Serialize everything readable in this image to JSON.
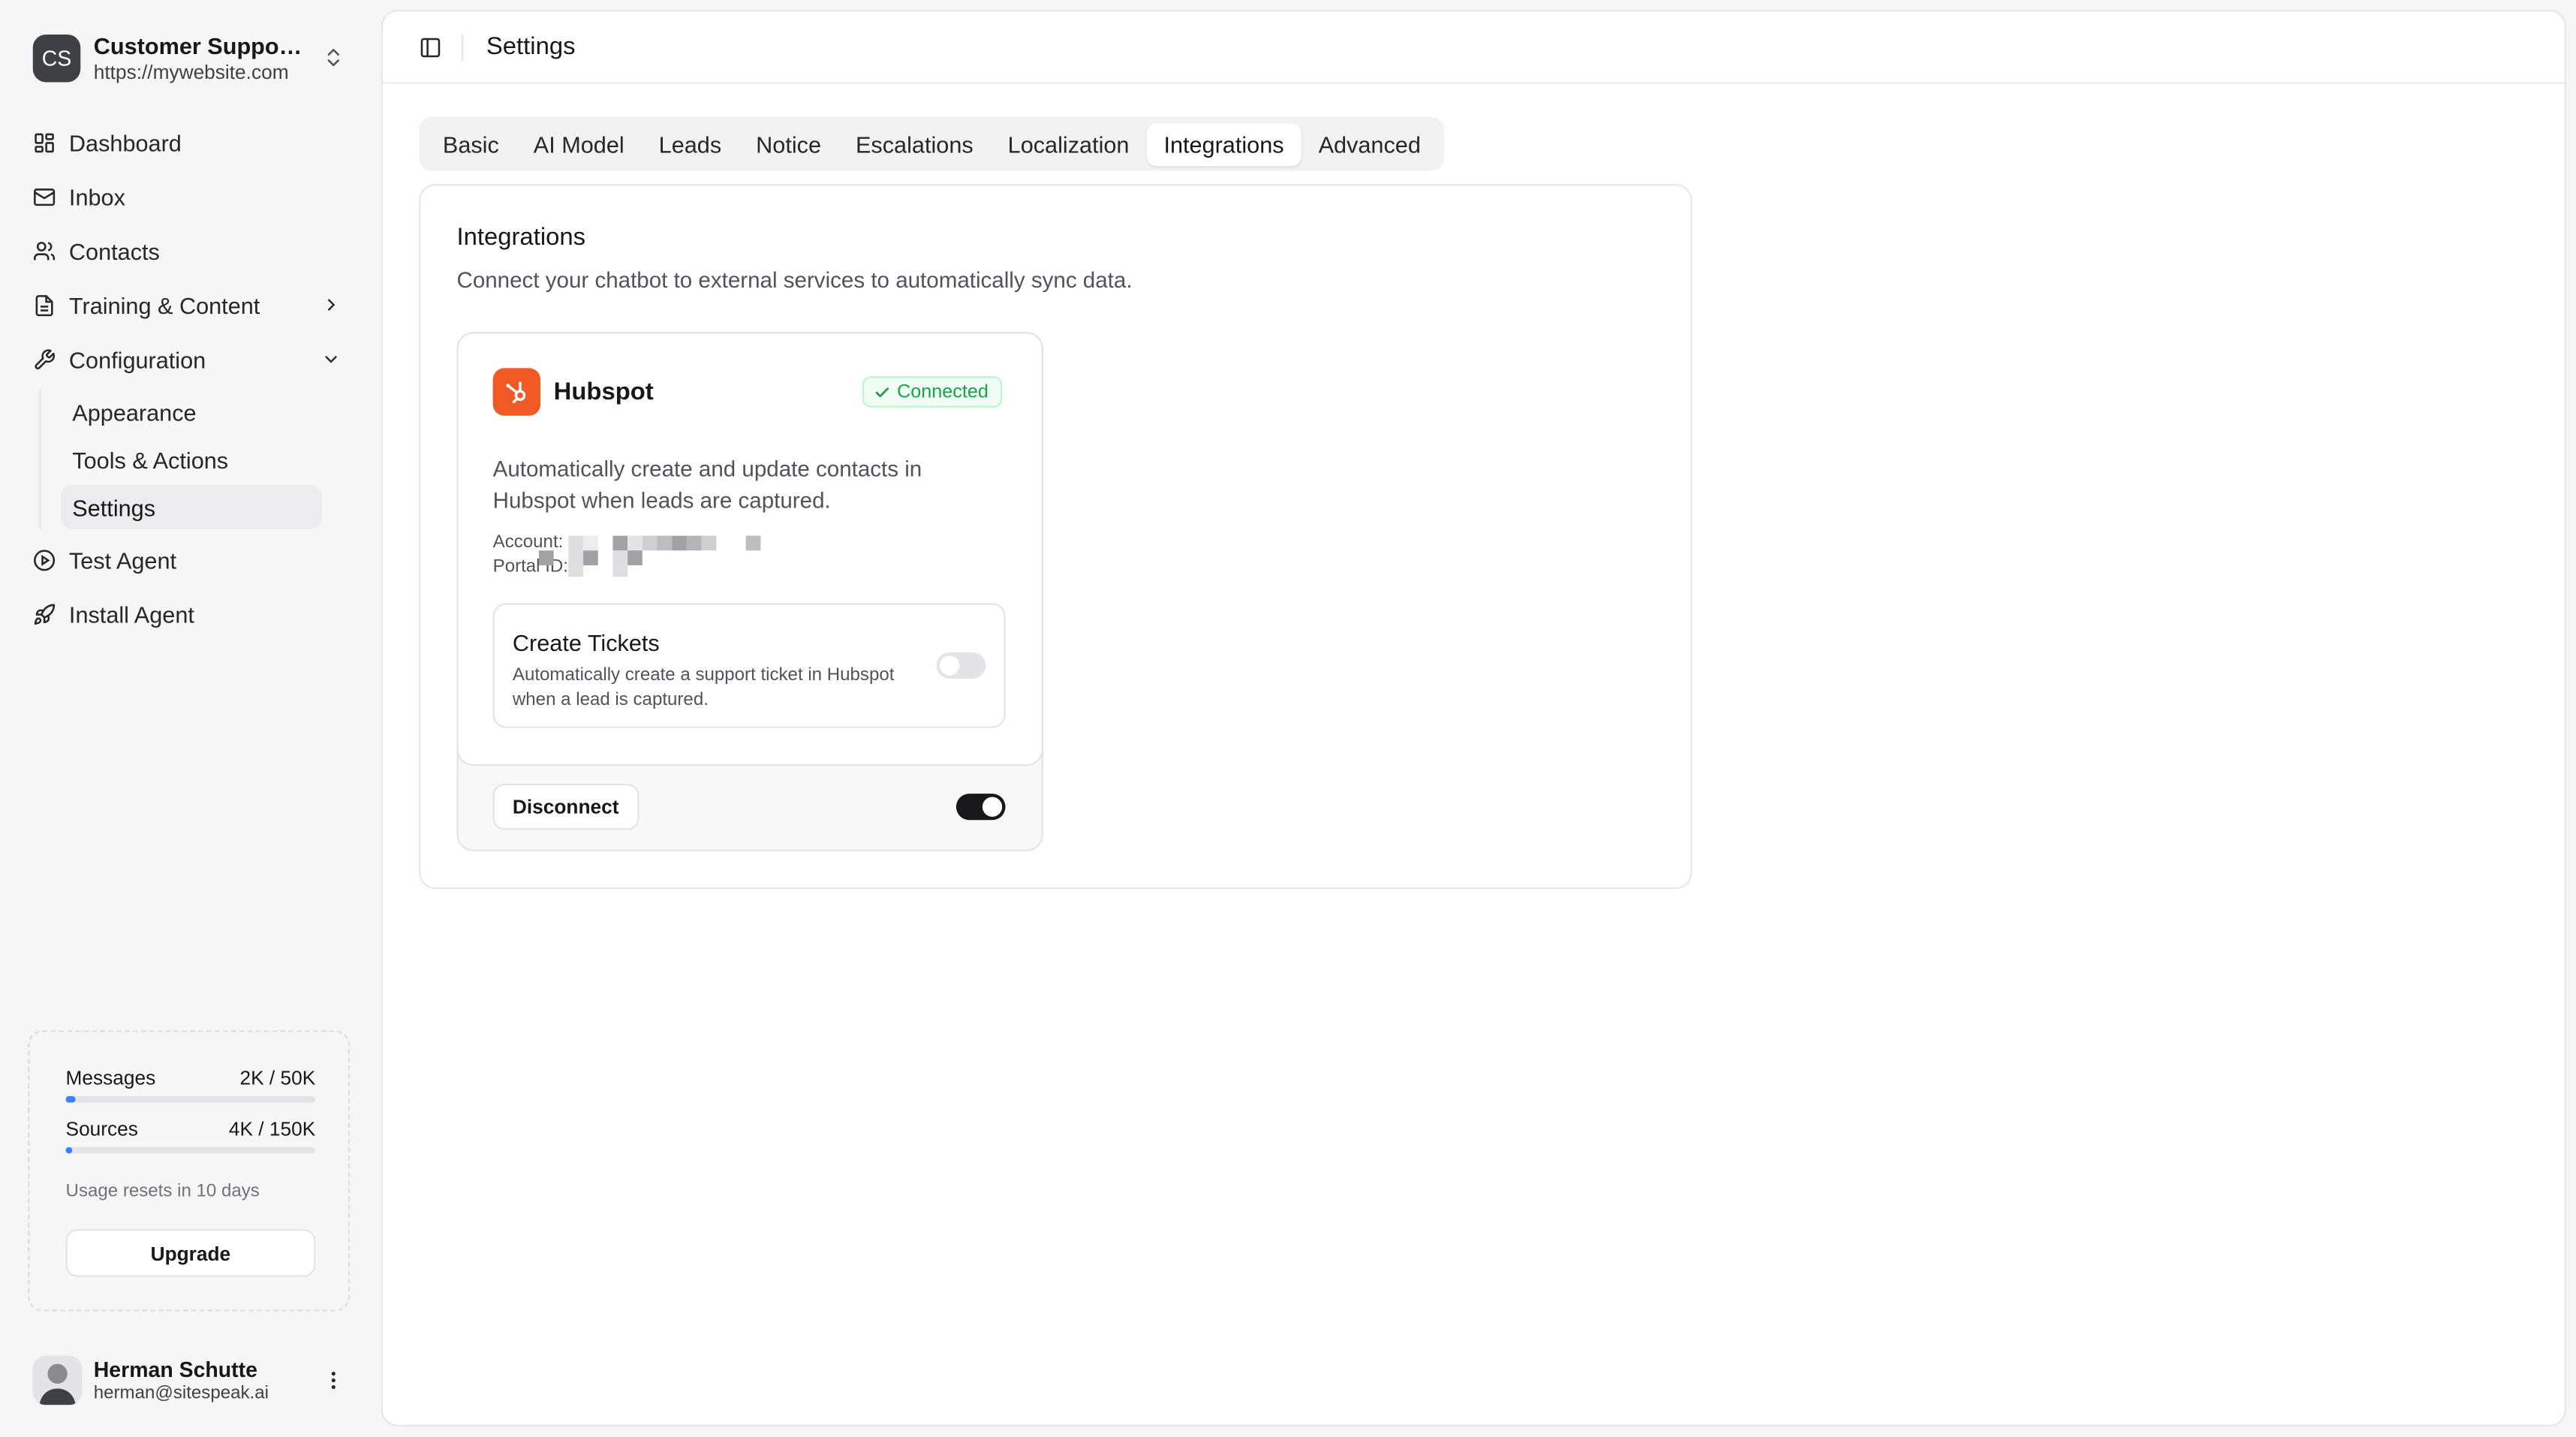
{
  "workspace": {
    "initials": "CS",
    "name": "Customer Support Agent",
    "url": "https://mywebsite.com"
  },
  "nav": {
    "items": [
      {
        "label": "Dashboard",
        "icon": "dashboard-icon"
      },
      {
        "label": "Inbox",
        "icon": "mail-icon"
      },
      {
        "label": "Contacts",
        "icon": "users-icon"
      },
      {
        "label": "Training & Content",
        "icon": "document-icon"
      },
      {
        "label": "Configuration",
        "icon": "wrench-icon"
      }
    ],
    "config_sub": [
      "Appearance",
      "Tools & Actions",
      "Settings"
    ],
    "bottom_items": [
      {
        "label": "Test Agent",
        "icon": "play-circle-icon"
      },
      {
        "label": "Install Agent",
        "icon": "rocket-icon"
      }
    ]
  },
  "usage": {
    "messages": {
      "label": "Messages",
      "value": "2K / 50K",
      "fraction": 0.04
    },
    "sources": {
      "label": "Sources",
      "value": "4K / 150K",
      "fraction": 0.027
    },
    "reset_text": "Usage resets in 10 days",
    "upgrade_label": "Upgrade"
  },
  "user": {
    "name": "Herman Schutte",
    "email": "herman@sitespeak.ai"
  },
  "header": {
    "title": "Settings"
  },
  "tabs": [
    "Basic",
    "AI Model",
    "Leads",
    "Notice",
    "Escalations",
    "Localization",
    "Integrations",
    "Advanced"
  ],
  "active_tab": "Integrations",
  "integrations": {
    "title": "Integrations",
    "subtitle": "Connect your chatbot to external services to automatically sync data.",
    "hubspot": {
      "name": "Hubspot",
      "status": "Connected",
      "description": "Automatically create and update contacts in Hubspot when leads are captured.",
      "account_label": "Account:",
      "portal_label": "Portal ID:",
      "create_tickets": {
        "title": "Create Tickets",
        "description": "Automatically create a support ticket in Hubspot when a lead is captured.",
        "enabled": false
      },
      "disconnect_label": "Disconnect",
      "integration_enabled": true
    }
  },
  "colors": {
    "accent": "#3b82f6",
    "hubspot": "#f15a24",
    "success": "#16a34a",
    "toggle_on": "#18181b"
  }
}
